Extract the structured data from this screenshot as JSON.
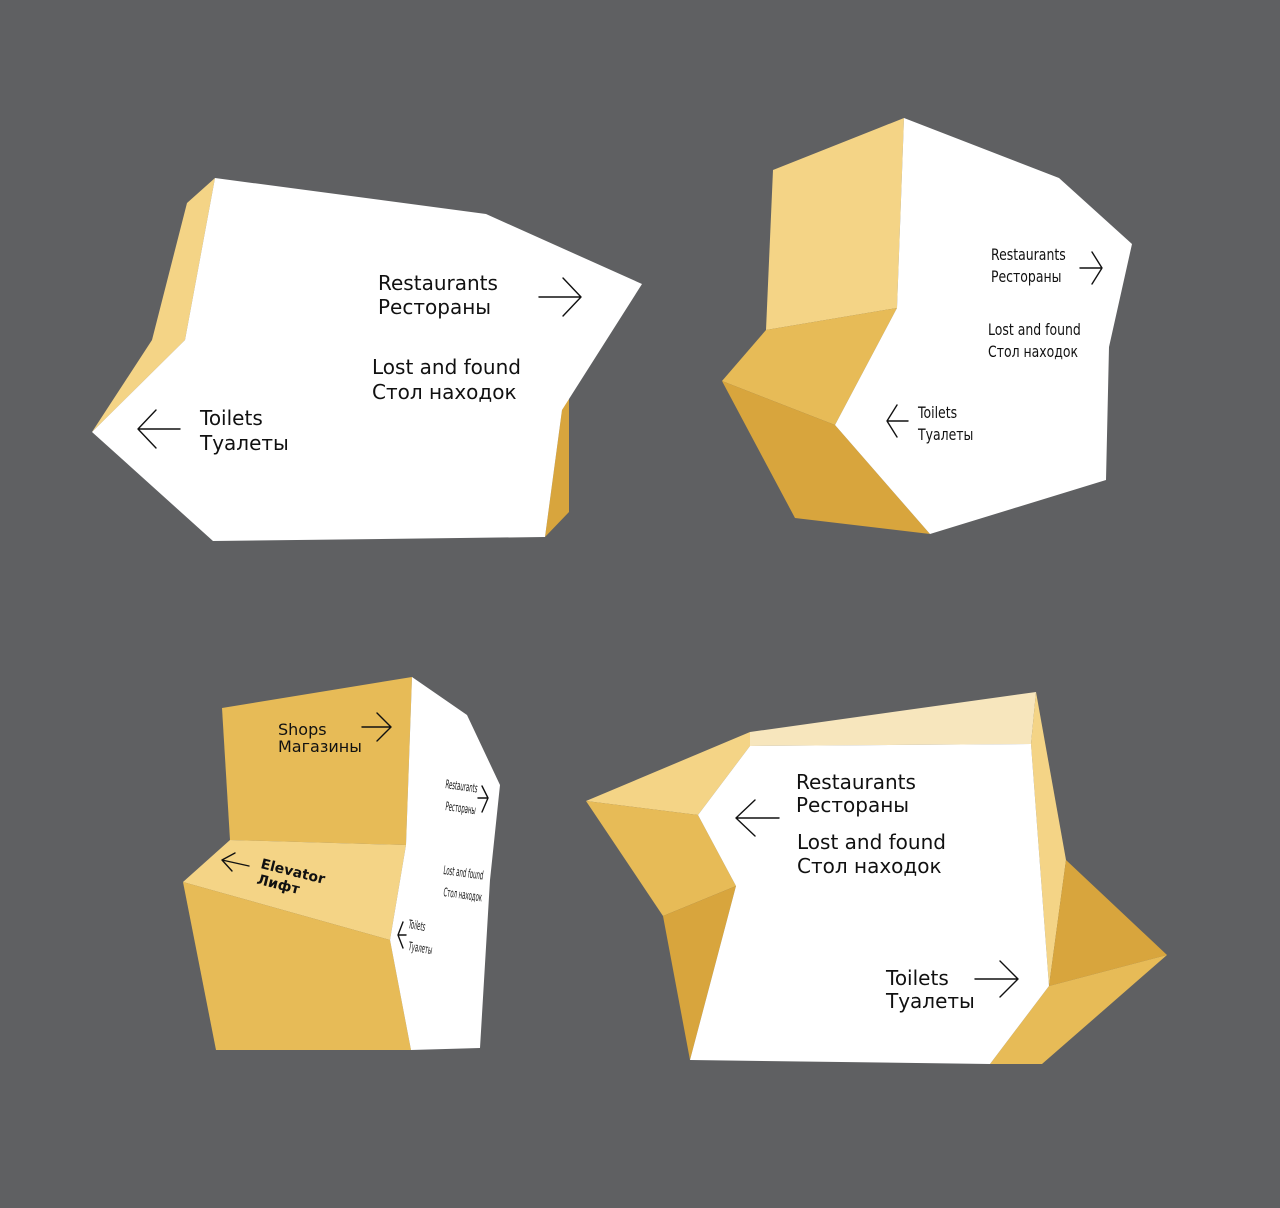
{
  "colors": {
    "background": "#5f6062",
    "face": "#ffffff",
    "yellow_light": "#f4d486",
    "yellow_mid": "#e7bb57",
    "yellow_dark": "#d8a53d",
    "yellow_pale": "#f7e6bd",
    "text": "#111111"
  },
  "sign1": {
    "restaurants": {
      "en": "Restaurants",
      "ru": "Рестораны",
      "arrow": "arrow-right-icon"
    },
    "lost_found": {
      "en": "Lost and found",
      "ru": "Стол находок"
    },
    "toilets": {
      "en": "Toilets",
      "ru": "Туалеты",
      "arrow": "arrow-left-icon"
    }
  },
  "sign2": {
    "restaurants": {
      "en": "Restaurants",
      "ru": "Рестораны",
      "arrow": "arrow-right-icon"
    },
    "lost_found": {
      "en": "Lost and found",
      "ru": "Стол находок"
    },
    "toilets": {
      "en": "Toilets",
      "ru": "Туалеты",
      "arrow": "arrow-left-icon"
    }
  },
  "sign3": {
    "shops": {
      "en": "Shops",
      "ru": "Магазины",
      "arrow": "arrow-right-icon"
    },
    "elevator": {
      "en": "Elevator",
      "ru": "Лифт",
      "arrow": "arrow-left-icon"
    },
    "restaurants": {
      "en": "Restaurants",
      "ru": "Рестораны",
      "arrow": "arrow-right-icon"
    },
    "lost_found": {
      "en": "Lost and found",
      "ru": "Стол находок"
    },
    "toilets": {
      "en": "Toilets",
      "ru": "Туалеты",
      "arrow": "arrow-left-icon"
    }
  },
  "sign4": {
    "restaurants": {
      "en": "Restaurants",
      "ru": "Рестораны",
      "arrow": "arrow-left-icon"
    },
    "lost_found": {
      "en": "Lost and found",
      "ru": "Стол находок"
    },
    "toilets": {
      "en": "Toilets",
      "ru": "Туалеты",
      "arrow": "arrow-right-icon"
    }
  }
}
